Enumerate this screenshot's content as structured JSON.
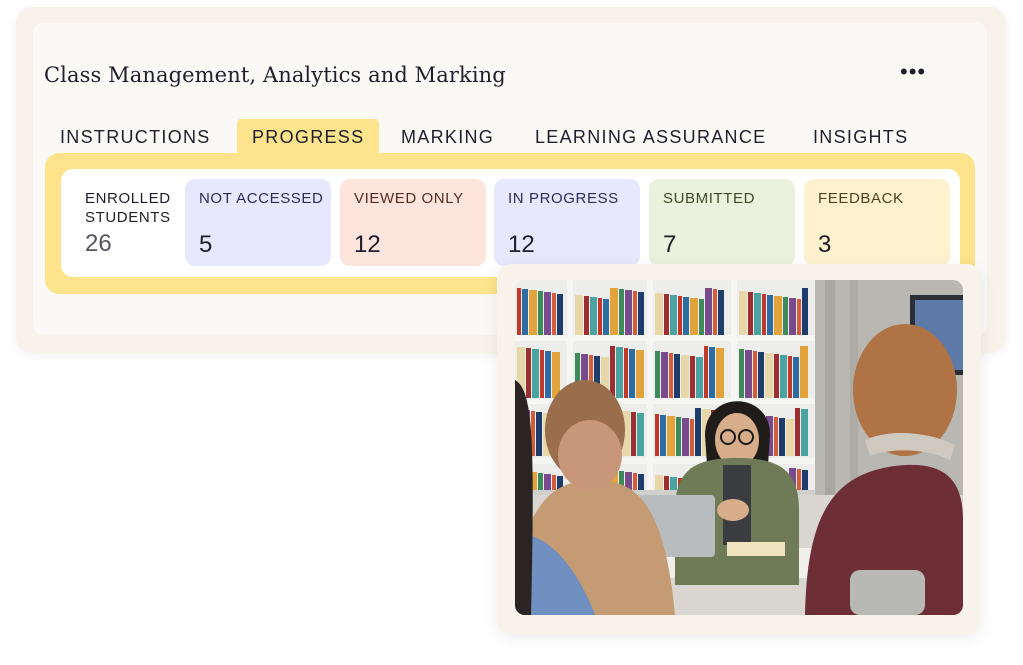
{
  "header": {
    "title": "Class Management, Analytics and Marking",
    "more_icon": "ellipsis-icon",
    "more_glyph": "•••"
  },
  "tabs": [
    {
      "label": "INSTRUCTIONS",
      "active": false
    },
    {
      "label": "PROGRESS",
      "active": true
    },
    {
      "label": "MARKING",
      "active": false
    },
    {
      "label": "LEARNING ASSURANCE",
      "active": false
    },
    {
      "label": "INSIGHTS",
      "active": false
    }
  ],
  "stats": {
    "enrolled": {
      "label_line1": "ENROLLED",
      "label_line2": "STUDENTS",
      "value": "26"
    },
    "cards": [
      {
        "label": "NOT ACCESSED",
        "value": "5",
        "bg": "#e7e8fd",
        "fg": "#2b2c58"
      },
      {
        "label": "VIEWED ONLY",
        "value": "12",
        "bg": "#fde4dc",
        "fg": "#5a2b22"
      },
      {
        "label": "IN PROGRESS",
        "value": "12",
        "bg": "#e7e8fd",
        "fg": "#2b2c58"
      },
      {
        "label": "SUBMITTED",
        "value": "7",
        "bg": "#eaf2dd",
        "fg": "#3d4a26"
      },
      {
        "label": "FEEDBACK",
        "value": "3",
        "bg": "#fdf1ce",
        "fg": "#4e4320"
      }
    ]
  },
  "colors": {
    "accent_yellow": "#fde38b",
    "card_bg": "#f7f2ea",
    "text": "#1e1f2a"
  }
}
